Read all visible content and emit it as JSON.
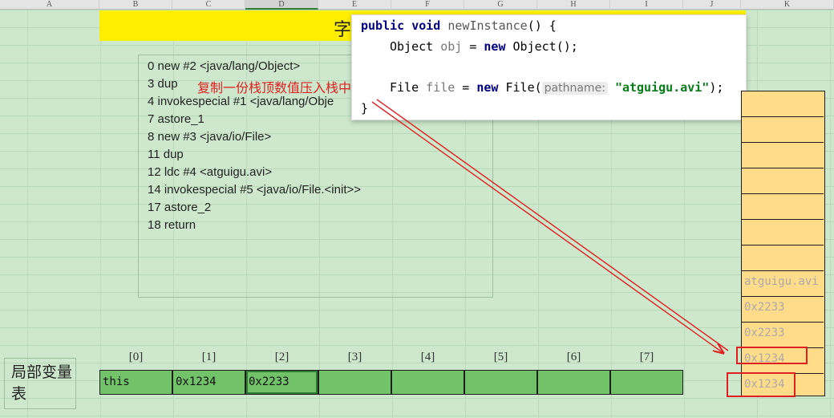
{
  "spreadsheet": {
    "columns": [
      "A",
      "B",
      "C",
      "D",
      "E",
      "F",
      "G",
      "H",
      "I",
      "J",
      "K"
    ],
    "active_column": "D"
  },
  "title_visible_fragment": "字",
  "bytecode": {
    "lines": [
      "0 new #2 <java/lang/Object>",
      "3 dup",
      "4 invokespecial #1 <java/lang/Obje",
      "7 astore_1",
      "8 new #3 <java/io/File>",
      "11 dup",
      "12 ldc #4 <atguigu.avi>",
      "14 invokespecial #5 <java/io/File.<init>>",
      "17 astore_2",
      "18 return"
    ],
    "annotation": "复制一份栈顶数值压入栈中"
  },
  "code_popup": {
    "line1": {
      "kw1": "public",
      "kw2": "void",
      "method": "newInstance",
      "rest": "() {"
    },
    "line2": {
      "type": "Object",
      "var": "obj",
      "eq": " = ",
      "kw": "new",
      "rest": " Object();"
    },
    "line3": {
      "type": "File",
      "var": "file",
      "eq": " = ",
      "kw": "new",
      "call": " File(",
      "hint": "pathname:",
      "str": "\"atguigu.avi\"",
      "end": ");"
    },
    "line4": "}"
  },
  "local_variable_table": {
    "label": "局部变量表",
    "indices": [
      "[0]",
      "[1]",
      "[2]",
      "[3]",
      "[4]",
      "[5]",
      "[6]",
      "[7]"
    ],
    "values": [
      "this",
      "0x1234",
      "0x2233",
      "",
      "",
      "",
      "",
      ""
    ]
  },
  "operand_stack": {
    "entries": [
      "atguigu.avi",
      "0x2233",
      "0x2233",
      "0x1234",
      "0x1234"
    ]
  },
  "colors": {
    "background": "#cde8cd",
    "title_yellow": "#ffee00",
    "cell_green": "#72c26a",
    "stack_orange": "#ffdc8a",
    "annotation_red": "#e02020"
  }
}
